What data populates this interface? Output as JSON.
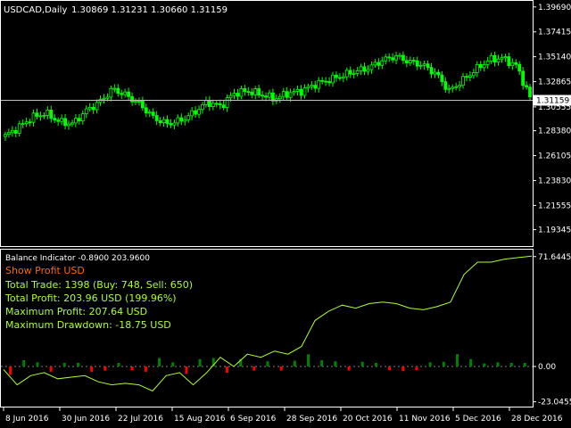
{
  "window": {
    "symbol_label": "USDCAD,Daily",
    "ohlc": "1.30869 1.31231 1.30660 1.31159",
    "current_price": "1.31159"
  },
  "indicator": {
    "header": "Balance Indicator -0.8900 203.9600",
    "mode_label": "Show Profit USD",
    "stats": [
      "Total Trade: 1398 (Buy: 748, Sell: 650)",
      "Total Profit: 203.96 USD (199.96%)",
      "Maximum Profit: 207.64 USD",
      "Maximum Drawdown: -18.75 USD"
    ]
  },
  "colors": {
    "background": "#000000",
    "axis": "#ffffff",
    "candle": "#00ff00",
    "balance_line": "#adff2f",
    "bar_positive": "#008000",
    "bar_negative": "#ff0000",
    "mode_label": "#ff6600",
    "stats_text": "#adff2f",
    "header_text": "#ffffff"
  },
  "chart_data": [
    {
      "type": "candlestick",
      "title": "USDCAD,Daily",
      "ylim": [
        1.18,
        1.4
      ],
      "y_ticks": [
        "1.39690",
        "1.37415",
        "1.35140",
        "1.32865",
        "1.30555",
        "1.28380",
        "1.26105",
        "1.23830",
        "1.21555",
        "1.19345"
      ],
      "x_tick_labels": [
        "8 Jun 2016",
        "30 Jun 2016",
        "22 Jul 2016",
        "15 Aug 2016",
        "6 Sep 2016",
        "28 Sep 2016",
        "20 Oct 2016",
        "11 Nov 2016",
        "5 Dec 2016",
        "28 Dec 2016"
      ],
      "horizontal_line": 1.31159,
      "close_path": [
        [
          "8 Jun 2016",
          1.279
        ],
        [
          "13 Jun 2016",
          1.287
        ],
        [
          "20 Jun 2016",
          1.296
        ],
        [
          "24 Jun 2016",
          1.3
        ],
        [
          "27 Jun 2016",
          1.292
        ],
        [
          "30 Jun 2016",
          1.29
        ],
        [
          "6 Jul 2016",
          1.302
        ],
        [
          "12 Jul 2016",
          1.31
        ],
        [
          "18 Jul 2016",
          1.322
        ],
        [
          "22 Jul 2016",
          1.316
        ],
        [
          "28 Jul 2016",
          1.308
        ],
        [
          "3 Aug 2016",
          1.296
        ],
        [
          "9 Aug 2016",
          1.29
        ],
        [
          "15 Aug 2016",
          1.293
        ],
        [
          "19 Aug 2016",
          1.3
        ],
        [
          "25 Aug 2016",
          1.31
        ],
        [
          "31 Aug 2016",
          1.306
        ],
        [
          "6 Sep 2016",
          1.318
        ],
        [
          "12 Sep 2016",
          1.32
        ],
        [
          "16 Sep 2016",
          1.317
        ],
        [
          "22 Sep 2016",
          1.313
        ],
        [
          "28 Sep 2016",
          1.318
        ],
        [
          "4 Oct 2016",
          1.32
        ],
        [
          "10 Oct 2016",
          1.326
        ],
        [
          "14 Oct 2016",
          1.33
        ],
        [
          "20 Oct 2016",
          1.334
        ],
        [
          "26 Oct 2016",
          1.338
        ],
        [
          "1 Nov 2016",
          1.341
        ],
        [
          "7 Nov 2016",
          1.348
        ],
        [
          "11 Nov 2016",
          1.352
        ],
        [
          "17 Nov 2016",
          1.347
        ],
        [
          "23 Nov 2016",
          1.344
        ],
        [
          "29 Nov 2016",
          1.336
        ],
        [
          "5 Dec 2016",
          1.32
        ],
        [
          "9 Dec 2016",
          1.33
        ],
        [
          "15 Dec 2016",
          1.34
        ],
        [
          "21 Dec 2016",
          1.349
        ],
        [
          "28 Dec 2016",
          1.35
        ],
        [
          "2 Jan 2017",
          1.343
        ],
        [
          "6 Jan 2017",
          1.314
        ]
      ]
    },
    {
      "type": "line",
      "title": "Balance Indicator",
      "ylim": [
        -25,
        75
      ],
      "y_ticks": [
        "71.6445",
        "0.00",
        "-23.0455"
      ],
      "x_tick_labels": [
        "8 Jun 2016",
        "30 Jun 2016",
        "22 Jul 2016",
        "15 Aug 2016",
        "6 Sep 2016",
        "28 Sep 2016",
        "20 Oct 2016",
        "11 Nov 2016",
        "5 Dec 2016",
        "28 Dec 2016"
      ],
      "balance": [
        [
          "8 Jun 2016",
          -2
        ],
        [
          "13 Jun 2016",
          -12
        ],
        [
          "20 Jun 2016",
          -6
        ],
        [
          "24 Jun 2016",
          -4
        ],
        [
          "27 Jun 2016",
          -8
        ],
        [
          "30 Jun 2016",
          -7
        ],
        [
          "6 Jul 2016",
          -6
        ],
        [
          "12 Jul 2016",
          -10
        ],
        [
          "18 Jul 2016",
          -12
        ],
        [
          "22 Jul 2016",
          -11
        ],
        [
          "28 Jul 2016",
          -12
        ],
        [
          "3 Aug 2016",
          -16
        ],
        [
          "9 Aug 2016",
          -6
        ],
        [
          "15 Aug 2016",
          -4
        ],
        [
          "19 Aug 2016",
          -12
        ],
        [
          "25 Aug 2016",
          -4
        ],
        [
          "31 Aug 2016",
          6
        ],
        [
          "6 Sep 2016",
          0
        ],
        [
          "12 Sep 2016",
          8
        ],
        [
          "16 Sep 2016",
          6
        ],
        [
          "22 Sep 2016",
          10
        ],
        [
          "28 Sep 2016",
          8
        ],
        [
          "4 Oct 2016",
          13
        ],
        [
          "10 Oct 2016",
          30
        ],
        [
          "14 Oct 2016",
          36
        ],
        [
          "20 Oct 2016",
          40
        ],
        [
          "26 Oct 2016",
          38
        ],
        [
          "1 Nov 2016",
          41
        ],
        [
          "7 Nov 2016",
          42
        ],
        [
          "11 Nov 2016",
          41
        ],
        [
          "17 Nov 2016",
          38
        ],
        [
          "23 Nov 2016",
          37
        ],
        [
          "29 Nov 2016",
          39
        ],
        [
          "5 Dec 2016",
          42
        ],
        [
          "9 Dec 2016",
          60
        ],
        [
          "15 Dec 2016",
          68
        ],
        [
          "21 Dec 2016",
          68
        ],
        [
          "28 Dec 2016",
          70
        ],
        [
          "2 Jan 2017",
          71
        ],
        [
          "6 Jan 2017",
          72
        ]
      ]
    }
  ]
}
